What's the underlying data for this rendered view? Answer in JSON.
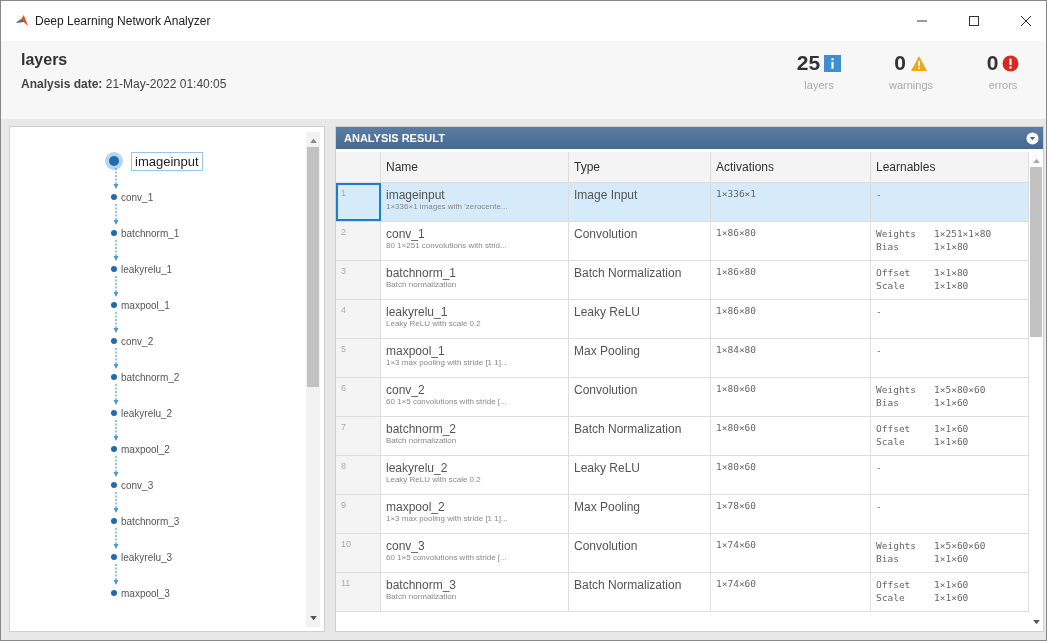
{
  "window": {
    "title": "Deep Learning Network Analyzer"
  },
  "header": {
    "title": "layers",
    "date_label": "Analysis date:",
    "date": "21-May-2022 01:40:05"
  },
  "summary": [
    {
      "kind": "info",
      "value": "25",
      "label": "layers"
    },
    {
      "kind": "warning",
      "value": "0",
      "label": "warnings"
    },
    {
      "kind": "error",
      "value": "0",
      "label": "errors"
    }
  ],
  "graph": {
    "nodes": [
      {
        "label": "imageinput",
        "selected": true
      },
      {
        "label": "conv_1",
        "selected": false
      },
      {
        "label": "batchnorm_1",
        "selected": false
      },
      {
        "label": "leakyrelu_1",
        "selected": false
      },
      {
        "label": "maxpool_1",
        "selected": false
      },
      {
        "label": "conv_2",
        "selected": false
      },
      {
        "label": "batchnorm_2",
        "selected": false
      },
      {
        "label": "leakyrelu_2",
        "selected": false
      },
      {
        "label": "maxpool_2",
        "selected": false
      },
      {
        "label": "conv_3",
        "selected": false
      },
      {
        "label": "batchnorm_3",
        "selected": false
      },
      {
        "label": "leakyrelu_3",
        "selected": false
      },
      {
        "label": "maxpool_3",
        "selected": false
      }
    ]
  },
  "table": {
    "title": "ANALYSIS RESULT",
    "columns": [
      "Name",
      "Type",
      "Activations",
      "Learnables"
    ],
    "rows": [
      {
        "index": "1",
        "selected": true,
        "name": "imageinput",
        "description": "1×336×1 images with 'zerocente...",
        "type": "Image Input",
        "activations": "1×336×1",
        "learnables": [
          {
            "name": "-"
          }
        ]
      },
      {
        "index": "2",
        "selected": false,
        "name": "conv_1",
        "description": "80 1×251 convolutions with strid...",
        "type": "Convolution",
        "activations": "1×86×80",
        "learnables": [
          {
            "name": "Weights",
            "size": "1×251×1×80"
          },
          {
            "name": "Bias",
            "size": "1×1×80"
          }
        ]
      },
      {
        "index": "3",
        "selected": false,
        "name": "batchnorm_1",
        "description": "Batch normalization",
        "type": "Batch Normalization",
        "activations": "1×86×80",
        "learnables": [
          {
            "name": "Offset",
            "size": "1×1×80"
          },
          {
            "name": "Scale",
            "size": "1×1×80"
          }
        ]
      },
      {
        "index": "4",
        "selected": false,
        "name": "leakyrelu_1",
        "description": "Leaky ReLU with scale 0.2",
        "type": "Leaky ReLU",
        "activations": "1×86×80",
        "learnables": [
          {
            "name": "-"
          }
        ]
      },
      {
        "index": "5",
        "selected": false,
        "name": "maxpool_1",
        "description": "1×3 max pooling with stride [1 1]...",
        "type": "Max Pooling",
        "activations": "1×84×80",
        "learnables": [
          {
            "name": "-"
          }
        ]
      },
      {
        "index": "6",
        "selected": false,
        "name": "conv_2",
        "description": "60 1×5 convolutions with stride [...",
        "type": "Convolution",
        "activations": "1×80×60",
        "learnables": [
          {
            "name": "Weights",
            "size": "1×5×80×60"
          },
          {
            "name": "Bias",
            "size": "1×1×60"
          }
        ]
      },
      {
        "index": "7",
        "selected": false,
        "name": "batchnorm_2",
        "description": "Batch normalization",
        "type": "Batch Normalization",
        "activations": "1×80×60",
        "learnables": [
          {
            "name": "Offset",
            "size": "1×1×60"
          },
          {
            "name": "Scale",
            "size": "1×1×60"
          }
        ]
      },
      {
        "index": "8",
        "selected": false,
        "name": "leakyrelu_2",
        "description": "Leaky ReLU with scale 0.2",
        "type": "Leaky ReLU",
        "activations": "1×80×60",
        "learnables": [
          {
            "name": "-"
          }
        ]
      },
      {
        "index": "9",
        "selected": false,
        "name": "maxpool_2",
        "description": "1×3 max pooling with stride [1 1]...",
        "type": "Max Pooling",
        "activations": "1×78×60",
        "learnables": [
          {
            "name": "-"
          }
        ]
      },
      {
        "index": "10",
        "selected": false,
        "name": "conv_3",
        "description": "60 1×5 convolutions with stride [...",
        "type": "Convolution",
        "activations": "1×74×60",
        "learnables": [
          {
            "name": "Weights",
            "size": "1×5×60×60"
          },
          {
            "name": "Bias",
            "size": "1×1×60"
          }
        ]
      },
      {
        "index": "11",
        "selected": false,
        "name": "batchnorm_3",
        "description": "Batch normalization",
        "type": "Batch Normalization",
        "activations": "1×74×60",
        "learnables": [
          {
            "name": "Offset",
            "size": "1×1×60"
          },
          {
            "name": "Scale",
            "size": "1×1×60"
          }
        ]
      }
    ]
  }
}
